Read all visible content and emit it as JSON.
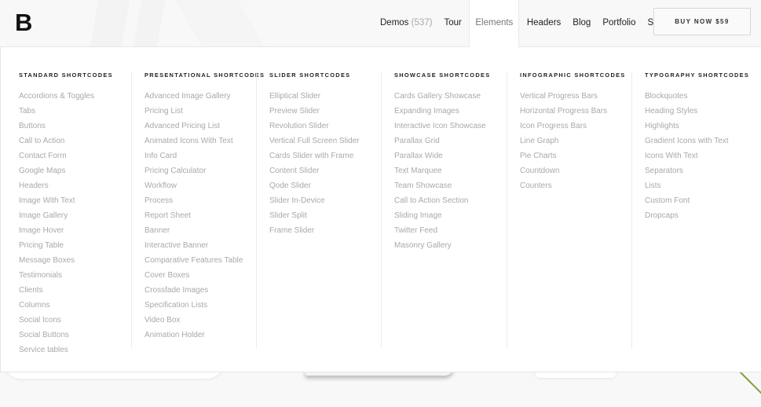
{
  "header": {
    "logo": "B",
    "nav": [
      {
        "label": "Demos",
        "count": "(537)"
      },
      {
        "label": "Tour"
      },
      {
        "label": "Elements",
        "active": true
      },
      {
        "label": "Headers"
      },
      {
        "label": "Blog"
      },
      {
        "label": "Portfolio"
      },
      {
        "label": "Shop"
      }
    ],
    "buy_button": "BUY NOW $59"
  },
  "mega_menu": {
    "columns": [
      {
        "title": "Standard Shortcodes",
        "items": [
          "Accordions & Toggles",
          "Tabs",
          "Buttons",
          "Call to Action",
          "Contact Form",
          "Google Maps",
          "Headers",
          "Image With Text",
          "Image Gallery",
          "Image Hover",
          "Pricing Table",
          "Message Boxes",
          "Testimonials",
          "Clients",
          "Columns",
          "Social Icons",
          "Social Buttons",
          "Service tables"
        ]
      },
      {
        "title": "Presentational Shortcodes",
        "items": [
          "Advanced Image Gallery",
          "Pricing List",
          "Advanced Pricing List",
          "Animated Icons With Text",
          "Info Card",
          "Pricing Calculator",
          "Workflow",
          "Process",
          "Report Sheet",
          "Banner",
          "Interactive Banner",
          "Comparative Features Table",
          "Cover Boxes",
          "Crossfade Images",
          "Specification Lists",
          "Video Box",
          "Animation Holder"
        ]
      },
      {
        "title": "Slider Shortcodes",
        "items": [
          "Elliptical Slider",
          "Preview Slider",
          "Revolution Slider",
          "Vertical Full Screen Slider",
          "Cards Slider with Frame",
          "Content Slider",
          "Qode Slider",
          "Slider In-Device",
          "Slider Split",
          "Frame Slider"
        ]
      },
      {
        "title": "Showcase Shortcodes",
        "items": [
          "Cards Gallery Showcase",
          "Expanding Images",
          "Interactive Icon Showcase",
          "Parallax Grid",
          "Parallax Wide",
          "Text Marquee",
          "Team Showcase",
          "Call to Action Section",
          "Sliding Image",
          "Twitter Feed",
          "Masonry Gallery"
        ]
      },
      {
        "title": "Infographic Shortcodes",
        "items": [
          "Vertical Progress Bars",
          "Horizontal Progress Bars",
          "Icon Progress Bars",
          "Line Graph",
          "Pie Charts",
          "Countdown",
          "Counters"
        ]
      },
      {
        "title": "Typography Shortcodes",
        "items": [
          "Blockquotes",
          "Heading Styles",
          "Highlights",
          "Gradient Icons with Text",
          "Icons With Text",
          "Separators",
          "Lists",
          "Custom Font",
          "Dropcaps"
        ]
      }
    ]
  },
  "colors": {
    "accent_line": "#7ea03a",
    "menu_item_text": "#a9a9a9",
    "heading_text": "#222222"
  }
}
